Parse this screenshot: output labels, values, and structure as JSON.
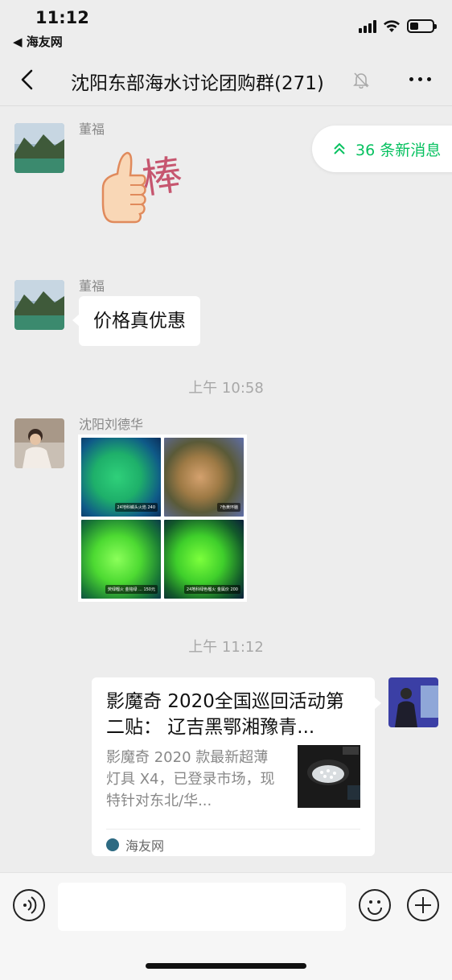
{
  "status_bar": {
    "time": "11:12",
    "back_app": "◀ 海友网"
  },
  "header": {
    "title": "沈阳东部海水讨论团购群(271)"
  },
  "new_messages": {
    "label": "36 条新消息"
  },
  "messages": [
    {
      "sender": "董福",
      "type": "sticker",
      "sticker_text": "棒"
    },
    {
      "sender": "董福",
      "type": "text",
      "text": "价格真优惠"
    },
    {
      "type": "timestamp",
      "text": "上午 10:58"
    },
    {
      "sender": "沈阳刘德华",
      "type": "image_grid",
      "captions": [
        "24地科鳞头火焰 240",
        "?色黄环脑",
        "荧绿榴火 金铭绿 ... 150元",
        "24地科绿色榴火 金属价 200"
      ]
    },
    {
      "type": "timestamp",
      "text": "上午 11:12"
    },
    {
      "type": "link_card",
      "title": "影魔奇 2020全国巡回活动第二贴： 辽吉黑鄂湘豫青...",
      "description": "影魔奇 2020 款最新超薄灯具 X4，已登录市场，现特针对东北/华...",
      "source": "海友网"
    }
  ],
  "colors": {
    "accent": "#07c160",
    "bg": "#ededed"
  }
}
